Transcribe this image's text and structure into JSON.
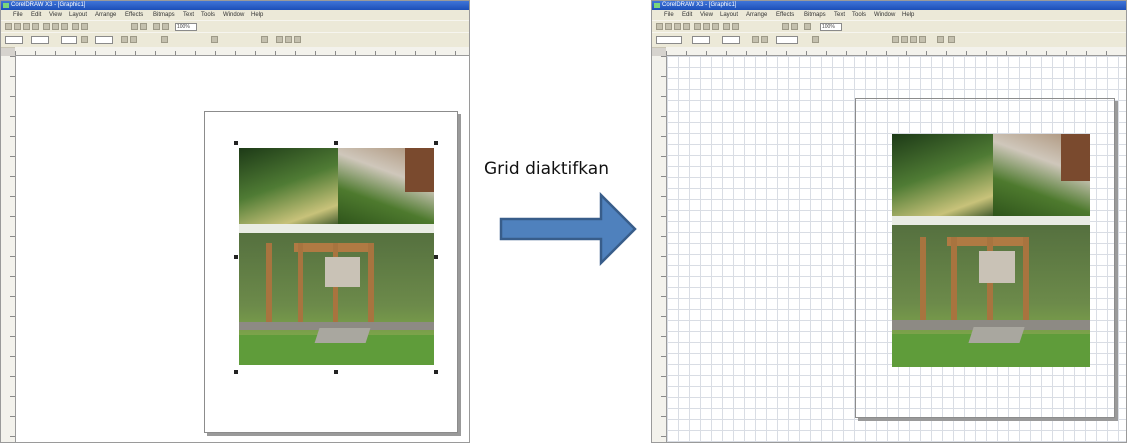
{
  "left_window": {
    "title": "CorelDRAW X3 - [Graphic1]",
    "menu": [
      "File",
      "Edit",
      "View",
      "Layout",
      "Arrange",
      "Effects",
      "Bitmaps",
      "Text",
      "Tools",
      "Window",
      "Help"
    ],
    "zoom": "100%"
  },
  "right_window": {
    "title": "CorelDRAW X3 - [Graphic1]",
    "menu": [
      "File",
      "Edit",
      "View",
      "Layout",
      "Arrange",
      "Effects",
      "Bitmaps",
      "Text",
      "Tools",
      "Window",
      "Help"
    ],
    "zoom": "100%"
  },
  "annotation": {
    "label": "Grid diaktifkan",
    "arrow_color": "#4f81bd",
    "arrow_border": "#385d8a"
  },
  "colors": {
    "grid_line": "#d9dde4",
    "titlebar": "#1c4fb8",
    "chrome": "#ece9d8"
  },
  "icons": [
    "app-icon",
    "toolbar-button-icon",
    "selection-handle-icon",
    "right-arrow-icon"
  ]
}
